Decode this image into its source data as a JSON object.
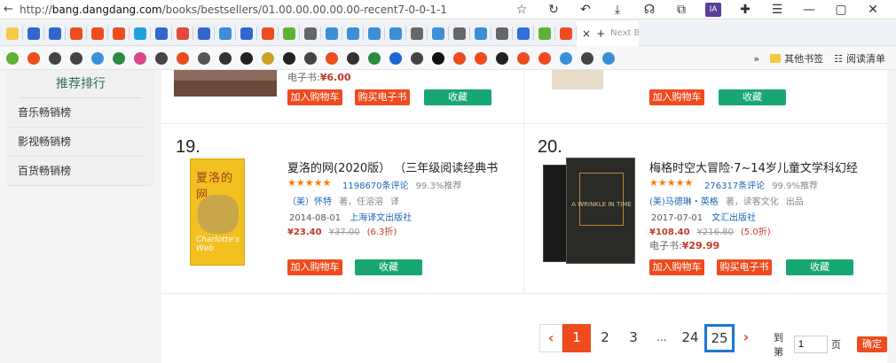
{
  "browser": {
    "url_prefix": "http://",
    "url_host": "bang.dangdang.com",
    "url_path": "/books/bestsellers/01.00.00.00.00.00-recent7-0-0-1-1",
    "active_tab_label": "Next Browser",
    "active_tab_close": "×",
    "new_tab": "+",
    "toolbar": [
      "☆",
      "↻",
      "↶",
      "⤓",
      "☊",
      "⧉",
      "IA",
      "✚",
      "☰",
      "—",
      "▢",
      "✕"
    ],
    "tab_icons": [
      "#f7c948",
      "#3366cc",
      "#3366cc",
      "#ee4b1e",
      "#ee4b1e",
      "#ee4b1e",
      "#1fa1d9",
      "#3366cc",
      "#e24a3c",
      "#3366cc",
      "#3b8fd8",
      "#3366cc",
      "#ee4b1e",
      "#5fb036",
      "#666666",
      "#3b8fd8",
      "#3b8fd8",
      "#3b8fd8",
      "#3b8fd8",
      "#666666",
      "#3b8fd8",
      "#666666",
      "#3b8fd8",
      "#666666",
      "#2f6fd6",
      "#5fb036",
      "#ee4b1e"
    ],
    "bookmarks_icons": [
      "#5fb036",
      "#ee4b1e",
      "#444444",
      "#444444",
      "#3b8fd8",
      "#2d8a3e",
      "#d9468a",
      "#444444",
      "#ee4b1e",
      "#555555",
      "#333333",
      "#222222",
      "#c9a227",
      "#222222",
      "#444444",
      "#ee4b1e",
      "#333333",
      "#2d8a3e",
      "#1a66d6",
      "#444444",
      "#111111",
      "#ee4b1e",
      "#ee4b1e",
      "#222222",
      "#ee4b1e",
      "#ee4b1e",
      "#3b8fd8",
      "#444444",
      "#3b8fd8"
    ],
    "bookmarks_more": "»",
    "other_bookmarks": "其他书签",
    "reading_list": "阅读清单"
  },
  "sidebar": {
    "title": "推荐排行",
    "items": [
      "音乐畅销榜",
      "影视畅销榜",
      "百货畅销榜"
    ]
  },
  "top_row": {
    "left_ebook_label": "电子书:",
    "left_ebook_price": "¥6.00",
    "left_cart": "加入购物车",
    "left_buy_ebook": "购买电子书",
    "left_fav": "收藏",
    "right_cart": "加入购物车",
    "right_fav": "收藏"
  },
  "books": [
    {
      "rank": "19.",
      "title": "夏洛的网(2020版） （三年级阅读经典书",
      "stars": 5,
      "reviews": "1198670条评论",
      "recommend": "99.3%推荐",
      "author_prefix": "（美）怀特",
      "author_role": "著，任溶溶",
      "translator": "译",
      "date": "2014-08-01",
      "publisher": "上海译文出版社",
      "price": "¥23.40",
      "orig_price": "¥37.00",
      "discount": "(6.3折)",
      "cart": "加入购物车",
      "fav": "收藏",
      "cover_title": "夏洛的网",
      "cover_sub": "Charlotte's Web"
    },
    {
      "rank": "20.",
      "title": "梅格时空大冒险·7~14岁儿童文学科幻经",
      "stars": 5,
      "reviews": "276317条评论",
      "recommend": "99.9%推荐",
      "author_prefix": "(美)马德琳・英格",
      "author_role": "著，读客文化",
      "translator": "出品",
      "date": "2017-07-01",
      "publisher": "文汇出版社",
      "price": "¥108.40",
      "orig_price": "¥216.80",
      "discount": "(5.0折)",
      "ebook_label": "电子书:",
      "ebook_price": "¥29.99",
      "cart": "加入购物车",
      "buy_ebook": "购买电子书",
      "fav": "收藏",
      "cover_text": "A WRINKLE IN TIME"
    }
  ],
  "pagination": {
    "prev": "‹",
    "pages": [
      "1",
      "2",
      "3",
      "...",
      "24",
      "25"
    ],
    "current": "1",
    "next": "›",
    "goto_prefix": "到第",
    "goto_value": "1",
    "goto_suffix": "页",
    "confirm": "确定"
  }
}
